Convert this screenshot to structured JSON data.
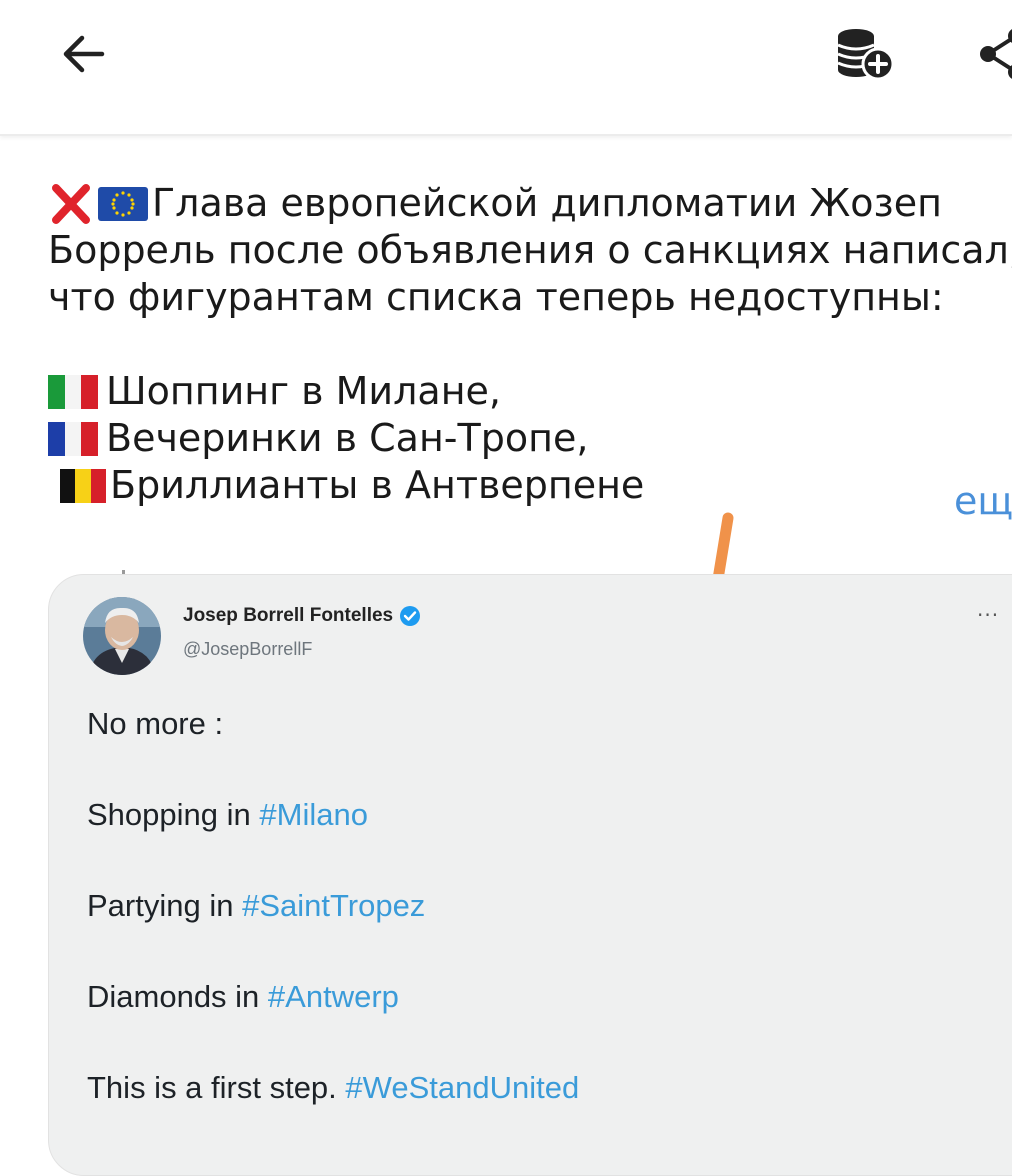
{
  "appbar": {
    "back_icon": "arrow-left-icon",
    "coins_icon": "coins-add-icon",
    "share_icon": "share-icon"
  },
  "post": {
    "line1": {
      "emojis": [
        "cross-mark-emoji",
        "eu-flag-emoji"
      ],
      "text": "Глава европейской дипломатии Жозеп"
    },
    "line2": "Боррель после объявления о санкциях написал,",
    "line3": "что фигурантам списка теперь недоступны:",
    "items": [
      {
        "flag": "italy-flag",
        "text": "Шоппинг в Милане,"
      },
      {
        "flag": "france-flag",
        "text": "Вечеринки в Сан-Тропе,"
      },
      {
        "flag": "belgium-flag",
        "text": "Бриллианты в Антверпене"
      }
    ],
    "more_label": "ещ"
  },
  "tweet": {
    "name": "Josep Borrell Fontelles",
    "handle": "@JosepBorrellF",
    "menu": "···",
    "lines": [
      {
        "text": "No more :",
        "hashtag": ""
      },
      {
        "text": "Shopping in ",
        "hashtag": "#Milano"
      },
      {
        "text": "Partying in ",
        "hashtag": "#SaintTropez"
      },
      {
        "text": "Diamonds in ",
        "hashtag": "#Antwerp"
      },
      {
        "text": "This is a first step. ",
        "hashtag": "#WeStandUnited"
      }
    ]
  },
  "colors": {
    "link": "#4a90d9",
    "hashtag": "#3a9bd9",
    "orange_mark": "#f0924a",
    "card_bg": "#eff0f0"
  }
}
